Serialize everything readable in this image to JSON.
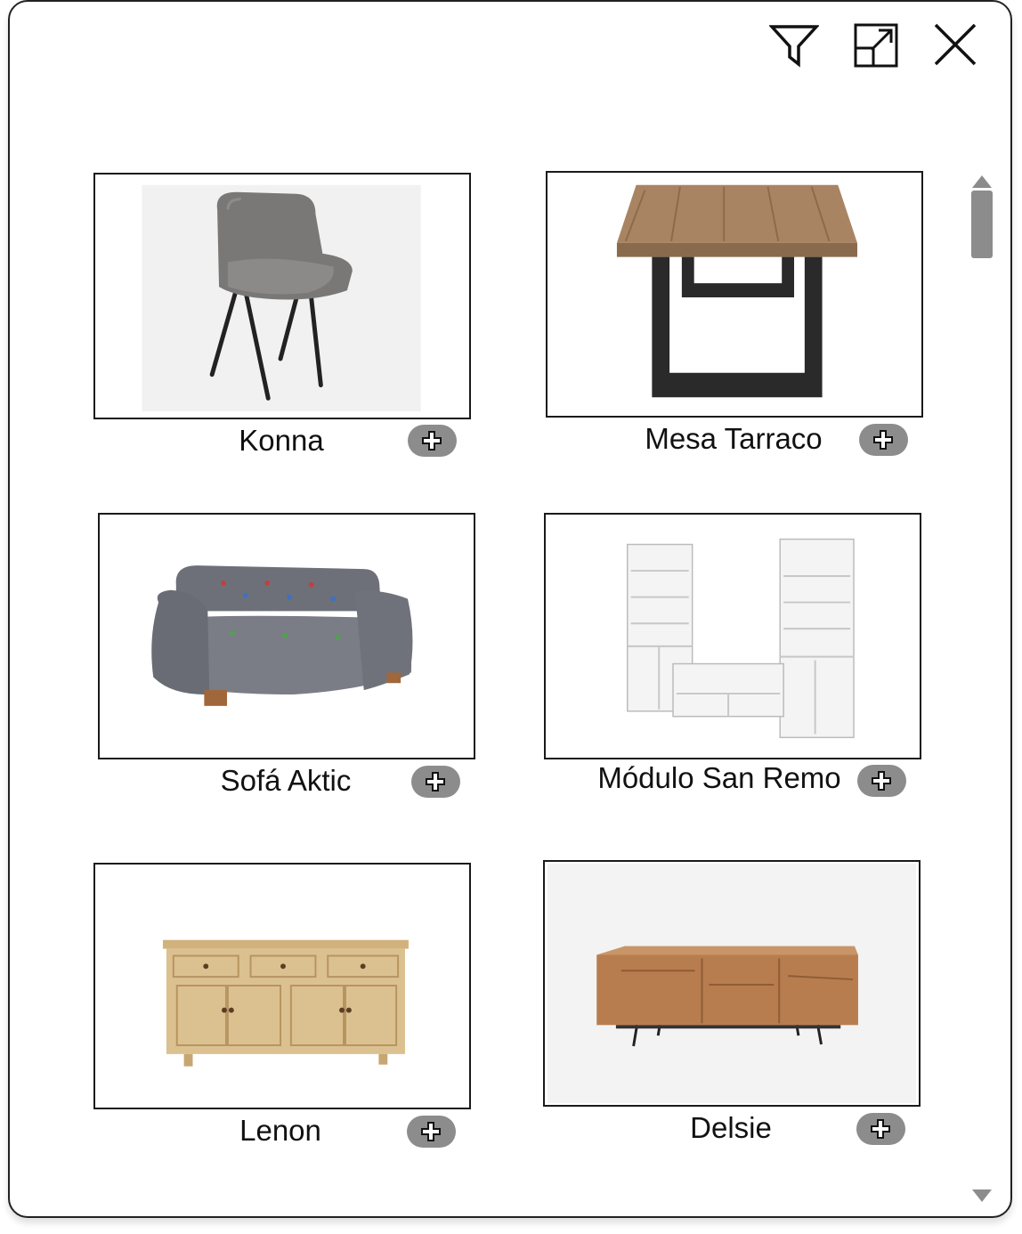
{
  "toolbar": {
    "filter_icon": "filter-icon",
    "expand_icon": "expand-icon",
    "close_icon": "close-icon"
  },
  "products": [
    {
      "name": "Konna",
      "image": "armchair",
      "add_icon": "plus-icon"
    },
    {
      "name": "Mesa Tarraco",
      "image": "dining-table",
      "add_icon": "plus-icon"
    },
    {
      "name": "Sofá Aktic",
      "image": "sofa",
      "add_icon": "plus-icon"
    },
    {
      "name": "Módulo San Remo",
      "image": "tv-unit",
      "add_icon": "plus-icon"
    },
    {
      "name": "Lenon",
      "image": "sideboard",
      "add_icon": "plus-icon"
    },
    {
      "name": "Delsie",
      "image": "tv-stand",
      "add_icon": "plus-icon"
    }
  ],
  "colors": {
    "button": "#8c8c8c",
    "border": "#1a1a1a"
  }
}
